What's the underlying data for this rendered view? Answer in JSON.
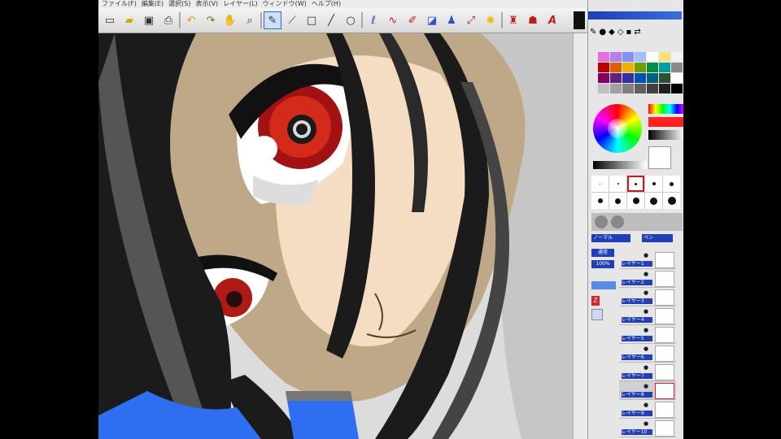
{
  "app": {
    "menu": [
      "ファイル(F)",
      "編集(E)",
      "選択(S)",
      "表示(V)",
      "レイヤー(L)",
      "ウィンドウ(W)",
      "ヘルプ(H)"
    ]
  },
  "toolbar": {
    "icons": [
      "new-file-icon",
      "open-folder-icon",
      "save-icon",
      "print-icon",
      "sep",
      "undo-icon",
      "redo-icon",
      "hand-icon",
      "zoom-icon",
      "sep",
      "pen-tool-icon",
      "eyedropper-icon",
      "rect-select-icon",
      "line-tool-icon",
      "ellipse-tool-icon",
      "sep",
      "lasso-icon",
      "curve-icon",
      "brush-icon",
      "fill-icon",
      "stamp-icon",
      "transform-icon",
      "magic-wand-icon",
      "sep",
      "airbrush-icon",
      "smudge-icon",
      "text-icon"
    ]
  },
  "palette": {
    "colors": [
      "#e070e0",
      "#b080f0",
      "#8090ff",
      "#a0c0ff",
      "#ffffff",
      "#ffe080",
      "#f0f0f0",
      "#c00000",
      "#e06000",
      "#f0b000",
      "#70a000",
      "#009040",
      "#00a0a0",
      "#8a8a8a",
      "#800060",
      "#602080",
      "#3030a0",
      "#0050b0",
      "#006080",
      "#305030",
      "#ffffff",
      "#c0c0c0",
      "#a0a0a0",
      "#808080",
      "#606060",
      "#404040",
      "#202020",
      "#000000"
    ]
  },
  "color_wheel": {
    "primary": "#ff2020",
    "secondary": "#ffffff"
  },
  "brush_panel": {
    "sizes": [
      1,
      2,
      3,
      4,
      5,
      6,
      7,
      8,
      9,
      10,
      14,
      16
    ],
    "selected_index": 2,
    "mode_label": "ノーマル",
    "tool_label": "ペン"
  },
  "layers": {
    "side_buttons": [
      "通常",
      "100%"
    ],
    "items": [
      {
        "name": "レイヤー1"
      },
      {
        "name": "レイヤー2"
      },
      {
        "name": "レイヤー3"
      },
      {
        "name": "レイヤー4"
      },
      {
        "name": "レイヤー5"
      },
      {
        "name": "レイヤー6"
      },
      {
        "name": "レイヤー7"
      },
      {
        "name": "レイヤー8"
      },
      {
        "name": "レイヤー9"
      },
      {
        "name": "レイヤー10"
      }
    ],
    "active_index": 7
  }
}
